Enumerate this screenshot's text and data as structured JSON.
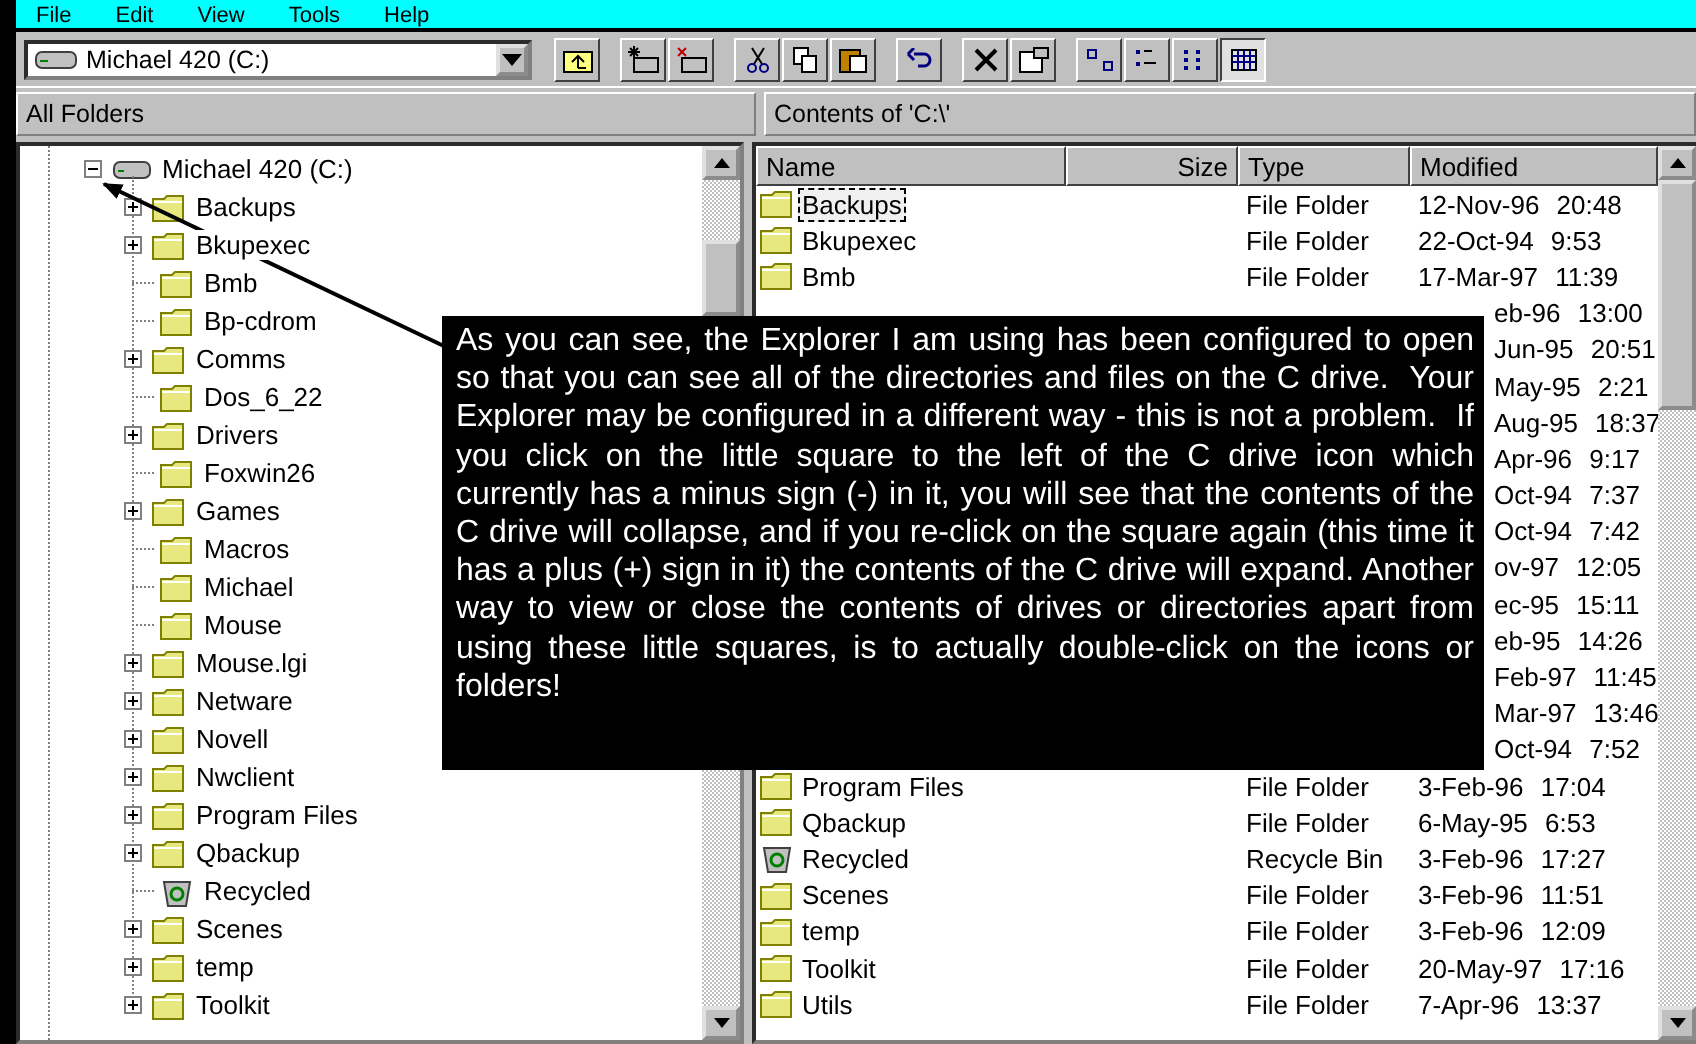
{
  "menu": [
    "File",
    "Edit",
    "View",
    "Tools",
    "Help"
  ],
  "address": {
    "value": "Michael 420 (C:)"
  },
  "view_buttons": [
    {
      "selected": false
    },
    {
      "selected": false
    },
    {
      "selected": false
    },
    {
      "selected": true
    }
  ],
  "panes": {
    "left_title": "All Folders",
    "right_title": "Contents of 'C:\\'"
  },
  "tree": {
    "label": "Michael 420 (C:)",
    "expanded": true,
    "children": [
      {
        "label": "Backups",
        "kind": "folder",
        "expandable": true
      },
      {
        "label": "Bkupexec",
        "kind": "folder",
        "expandable": true
      },
      {
        "label": "Bmb",
        "kind": "folder",
        "expandable": false
      },
      {
        "label": "Bp-cdrom",
        "kind": "folder",
        "expandable": false
      },
      {
        "label": "Comms",
        "kind": "folder",
        "expandable": true
      },
      {
        "label": "Dos_6_22",
        "kind": "folder",
        "expandable": false
      },
      {
        "label": "Drivers",
        "kind": "folder",
        "expandable": true
      },
      {
        "label": "Foxwin26",
        "kind": "folder",
        "expandable": false
      },
      {
        "label": "Games",
        "kind": "folder",
        "expandable": true
      },
      {
        "label": "Macros",
        "kind": "folder",
        "expandable": false
      },
      {
        "label": "Michael",
        "kind": "folder",
        "expandable": false
      },
      {
        "label": "Mouse",
        "kind": "folder",
        "expandable": false
      },
      {
        "label": "Mouse.lgi",
        "kind": "folder",
        "expandable": true
      },
      {
        "label": "Netware",
        "kind": "folder",
        "expandable": true
      },
      {
        "label": "Novell",
        "kind": "folder",
        "expandable": true
      },
      {
        "label": "Nwclient",
        "kind": "folder",
        "expandable": true
      },
      {
        "label": "Program Files",
        "kind": "folder",
        "expandable": true
      },
      {
        "label": "Qbackup",
        "kind": "folder",
        "expandable": true
      },
      {
        "label": "Recycled",
        "kind": "recycle",
        "expandable": false
      },
      {
        "label": "Scenes",
        "kind": "folder",
        "expandable": true
      },
      {
        "label": "temp",
        "kind": "folder",
        "expandable": true
      },
      {
        "label": "Toolkit",
        "kind": "folder",
        "expandable": true
      }
    ]
  },
  "list": {
    "columns": [
      "Name",
      "Size",
      "Type",
      "Modified"
    ],
    "rows": [
      {
        "name": "Backups",
        "kind": "folder",
        "type": "File Folder",
        "modified": "12-Nov-96 20:48",
        "focused": true
      },
      {
        "name": "Bkupexec",
        "kind": "folder",
        "type": "File Folder",
        "modified": "22-Oct-94 9:53",
        "focused": false
      },
      {
        "name": "Bmb",
        "kind": "folder",
        "type": "File Folder",
        "modified": "17-Mar-97 11:39",
        "focused": false
      },
      {
        "kind": "covered",
        "modified": "eb-96 13:00"
      },
      {
        "kind": "covered",
        "modified": "Jun-95 20:51"
      },
      {
        "kind": "covered",
        "modified": "May-95 2:21"
      },
      {
        "kind": "covered",
        "modified": "Aug-95 18:37"
      },
      {
        "kind": "covered",
        "modified": "Apr-96 9:17"
      },
      {
        "kind": "covered",
        "modified": "Oct-94 7:37"
      },
      {
        "kind": "covered",
        "modified": "Oct-94 7:42"
      },
      {
        "kind": "covered",
        "modified": "ov-97 12:05"
      },
      {
        "kind": "covered",
        "modified": "ec-95 15:11"
      },
      {
        "kind": "covered",
        "modified": "eb-95 14:26"
      },
      {
        "kind": "covered",
        "modified": "Feb-97 11:45"
      },
      {
        "kind": "covered",
        "modified": "Mar-97 13:46"
      },
      {
        "kind": "covered",
        "modified": "Oct-94 7:52"
      },
      {
        "name": "Program Files",
        "kind": "folder",
        "type": "File Folder",
        "modified": "3-Feb-96 17:04",
        "focused": false
      },
      {
        "name": "Qbackup",
        "kind": "folder",
        "type": "File Folder",
        "modified": "6-May-95 6:53",
        "focused": false
      },
      {
        "name": "Recycled",
        "kind": "recycle",
        "type": "Recycle Bin",
        "modified": "3-Feb-96 17:27",
        "focused": false
      },
      {
        "name": "Scenes",
        "kind": "folder",
        "type": "File Folder",
        "modified": "3-Feb-96 11:51",
        "focused": false
      },
      {
        "name": "temp",
        "kind": "folder",
        "type": "File Folder",
        "modified": "3-Feb-96 12:09",
        "focused": false
      },
      {
        "name": "Toolkit",
        "kind": "folder",
        "type": "File Folder",
        "modified": "20-May-97 17:16",
        "focused": false
      },
      {
        "name": "Utils",
        "kind": "folder",
        "type": "File Folder",
        "modified": "7-Apr-96 13:37",
        "focused": false
      }
    ]
  },
  "callout": {
    "text": "As you can see, the Explorer I am using has been configured to open so that you can see all of the directories and files on the C drive.  Your Explorer may be configured in a different way - this is not a problem.  If you click on the little square to the left of the C drive icon which currently has a minus sign (-) in it, you will see that the contents of the C drive will collapse, and if you re-click on the square again (this time it has a plus (+) sign in it) the contents of the C drive will expand. Another way to view or close the contents of drives or directories apart from using these little squares, is to actually double-click on the icons or folders!"
  }
}
